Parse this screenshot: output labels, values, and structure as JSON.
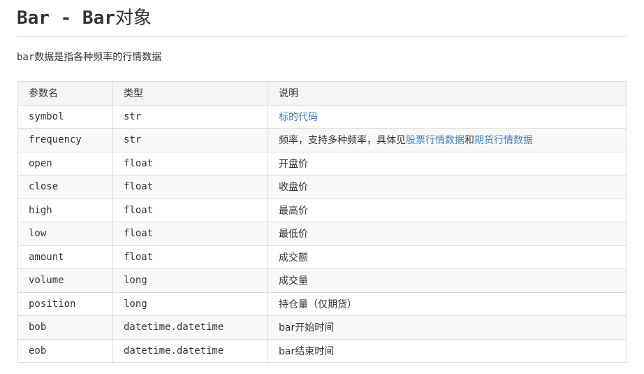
{
  "heading": {
    "code": "Bar - Bar",
    "suffix": "对象"
  },
  "description": {
    "code": "bar",
    "text": "数据是指各种频率的行情数据"
  },
  "table": {
    "headers": [
      "参数名",
      "类型",
      "说明"
    ],
    "rows": [
      {
        "name": "symbol",
        "type": "str",
        "desc": "",
        "link1": "标的代码"
      },
      {
        "name": "frequency",
        "type": "str",
        "desc": "频率，支持多种频率，具体见",
        "link1": "股票行情数据",
        "join": "和",
        "link2": "期货行情数据"
      },
      {
        "name": "open",
        "type": "float",
        "desc": "开盘价"
      },
      {
        "name": "close",
        "type": "float",
        "desc": "收盘价"
      },
      {
        "name": "high",
        "type": "float",
        "desc": "最高价"
      },
      {
        "name": "low",
        "type": "float",
        "desc": "最低价"
      },
      {
        "name": "amount",
        "type": "float",
        "desc": "成交额"
      },
      {
        "name": "volume",
        "type": "long",
        "desc": "成交量"
      },
      {
        "name": "position",
        "type": "long",
        "desc": "持仓量（仅期货）"
      },
      {
        "name": "bob",
        "type": "datetime.datetime",
        "desc": "",
        "desc_code": "bar",
        "desc_rest": "开始时间"
      },
      {
        "name": "eob",
        "type": "datetime.datetime",
        "desc": "",
        "desc_code": "bar",
        "desc_rest": "结束时间"
      }
    ]
  },
  "colors": {
    "link": "#4183c4",
    "border": "#dddddd",
    "header_bg": "#f4f4f4",
    "stripe_bg": "#f8f8f8"
  }
}
